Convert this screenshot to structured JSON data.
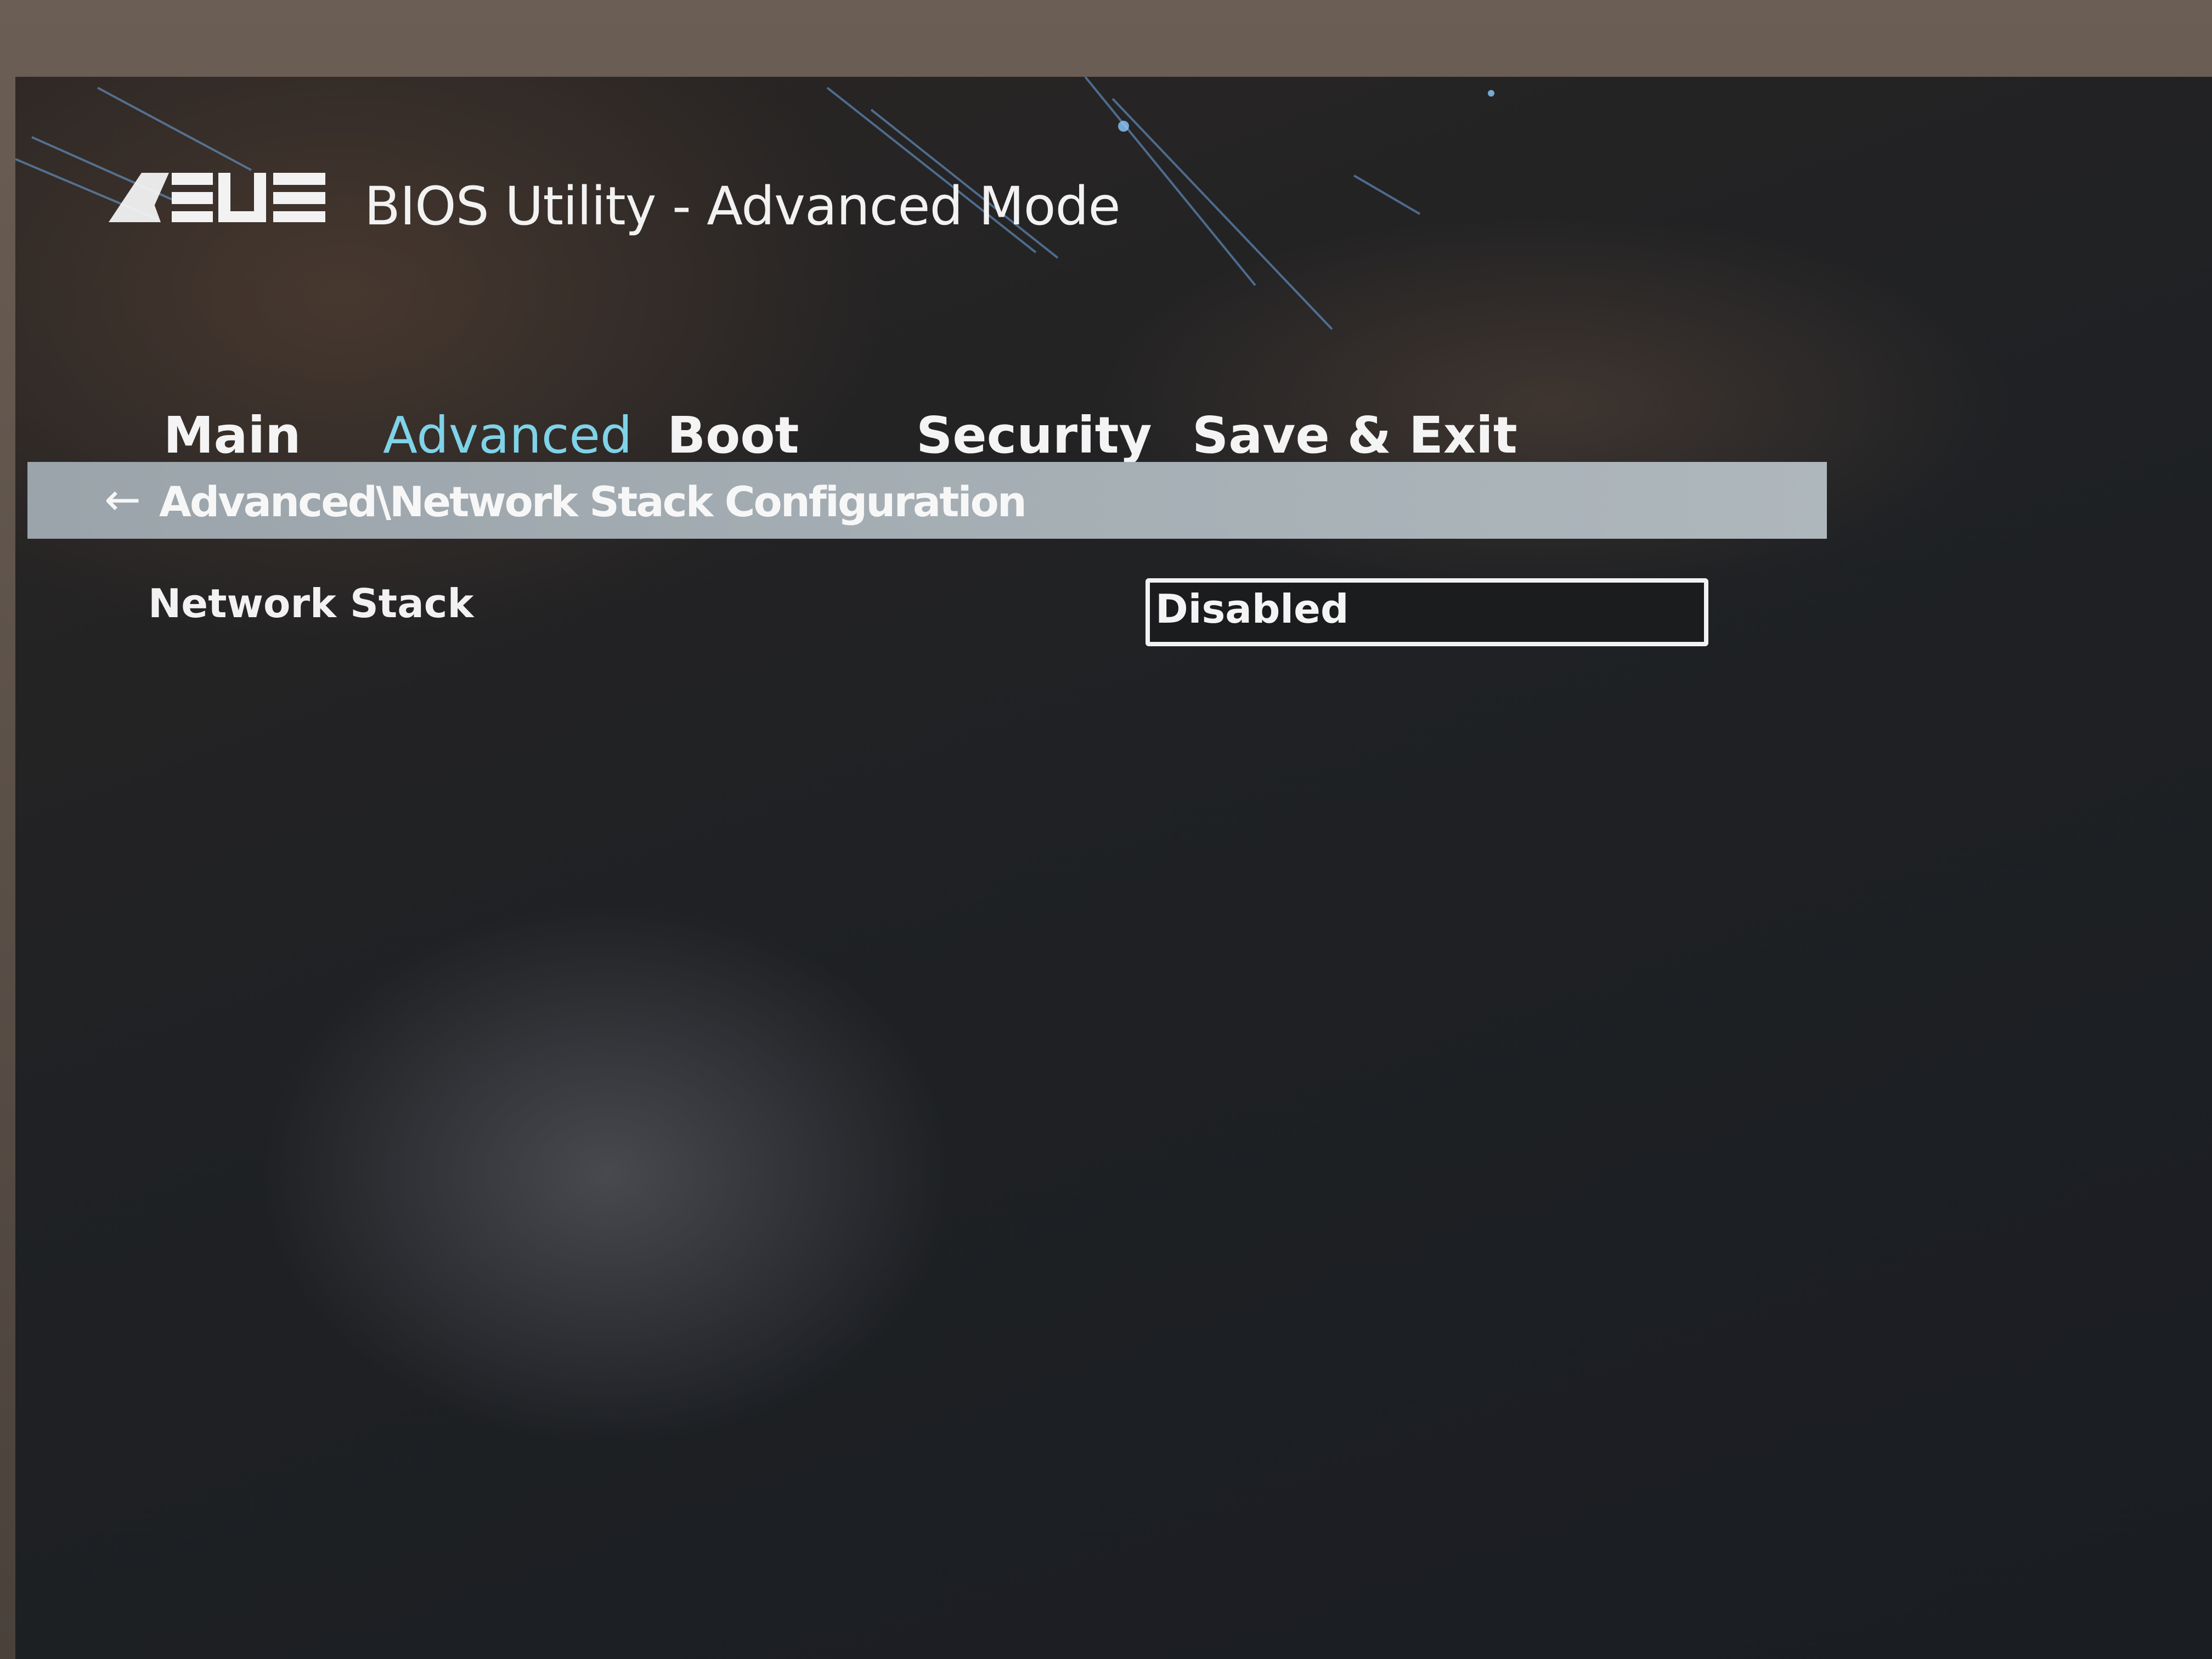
{
  "header": {
    "brand": "ASUS",
    "title": "BIOS Utility - Advanced Mode"
  },
  "tabs": [
    {
      "label": "Main",
      "active": false
    },
    {
      "label": "Advanced",
      "active": true
    },
    {
      "label": "Boot",
      "active": false
    },
    {
      "label": "Security",
      "active": false
    },
    {
      "label": "Save & Exit",
      "active": false
    }
  ],
  "breadcrumb": {
    "back_icon": "left-arrow-icon",
    "path": "Advanced\\Network Stack Configuration"
  },
  "settings": [
    {
      "label": "Network Stack",
      "value": "Disabled"
    }
  ],
  "colors": {
    "accent": "#7fd3e8",
    "breadcrumb_bar": "#a6afb4",
    "text": "#f2f2f2"
  }
}
